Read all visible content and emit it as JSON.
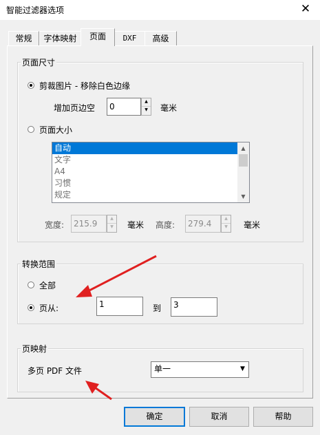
{
  "window": {
    "title": "智能过滤器选项",
    "close_glyph": "✕"
  },
  "tabs": [
    "常规",
    "字体映射",
    "页面",
    "DXF",
    "高级"
  ],
  "active_tab": 2,
  "page_size_group": {
    "label": "页面尺寸",
    "crop_option": {
      "label": "剪裁图片 - 移除白色边缘",
      "selected": true
    },
    "margin": {
      "label": "增加页边空",
      "value": "0",
      "unit": "毫米"
    },
    "page_size_option": {
      "label": "页面大小",
      "selected": false
    },
    "size_list": {
      "items": [
        "自动",
        "文字",
        "A4",
        "习惯",
        "规定"
      ],
      "selected_index": 0
    },
    "width": {
      "label": "宽度:",
      "value": "215.9",
      "unit": "毫米"
    },
    "height": {
      "label": "高度:",
      "value": "279.4",
      "unit": "毫米"
    }
  },
  "range_group": {
    "label": "转换范围",
    "all_option": {
      "label": "全部",
      "selected": false
    },
    "pages_option": {
      "label": "页从:",
      "selected": true
    },
    "from_value": "1",
    "to_label": "到",
    "to_value": "3"
  },
  "mapping_group": {
    "label": "页映射",
    "multipage_label": "多页 PDF 文件",
    "multipage_value": "单一"
  },
  "buttons": {
    "ok": "确定",
    "cancel": "取消",
    "help": "帮助"
  },
  "annotation_color": "#e02020"
}
